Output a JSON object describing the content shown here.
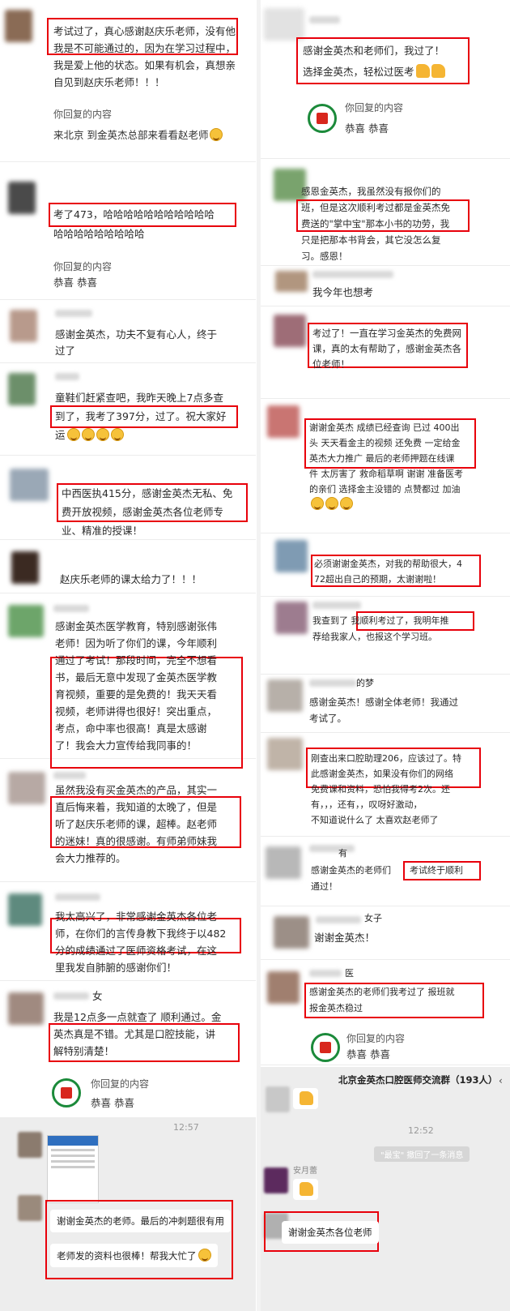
{
  "left_posts": [
    {
      "text": "考试过了，真心感谢赵庆乐老师，没有他我是不可能通过的，因为在学习过程中，我是爱上他的状态。如果有机会，真想亲自见到赵庆乐老师！！！",
      "reply_label": "你回复的内容",
      "reply_body": "来北京 到金英杰总部来看看赵老师"
    },
    {
      "text1": "考了473，哈哈哈哈哈哈哈哈哈哈哈",
      "text2": "哈哈哈哈哈哈哈哈哈",
      "reply_label": "你回复的内容",
      "reply_body": "恭喜 恭喜"
    },
    {
      "text1": "感谢金英杰，功夫不复有心人，终于",
      "text2": "过了"
    },
    {
      "text1": "童鞋们赶紧查吧，我昨天晚上7点多查",
      "text2": "到了，我考了397分，过了。祝大家好",
      "text3": "运"
    },
    {
      "text1": "中西医执415分，感谢金英杰无私、免",
      "text2": "费开放视频，感谢金英杰各位老师专",
      "text3": "业、精准的授课！"
    },
    {
      "text": "赵庆乐老师的课太给力了！！！"
    },
    {
      "lines": [
        "感谢金英杰医学教育，特别感谢张伟",
        "老师！因为听了你们的课，今年顺利",
        "通过了考试！那段时间，完全不想看",
        "书，最后无意中发现了金英杰医学教",
        "育视频，重要的是免费的！我天天看",
        "视频，老师讲得也很好！突出重点，",
        "考点，命中率也很高！真是太感谢",
        "了！我会大力宣传给我同事的！"
      ]
    },
    {
      "lines": [
        "虽然我没有买金英杰的产品，其实一",
        "直后悔来着，我知道的太晚了，但是",
        "听了赵庆乐老师的课，超棒。赵老师",
        "的迷妹！真的很感谢。有师弟师妹我",
        "会大力推荐的。"
      ]
    },
    {
      "lines": [
        "我太高兴了，非常感谢金英杰各位老",
        "师，在你们的言传身教下我终于以482",
        "分的成绩通过了医师资格考试，在这",
        "里我发自肺腑的感谢你们！"
      ]
    },
    {
      "name_char": "女",
      "lines": [
        "我是12点多一点就查了 顺利通过。金",
        "英杰真是不错。尤其是口腔技能，讲",
        "解特别清楚！"
      ],
      "reply_label": "你回复的内容",
      "reply_body": "恭喜 恭喜"
    }
  ],
  "left_chat": {
    "time": "12:57",
    "bubble1": "谢谢金英杰的老师。最后的冲刺题很有用",
    "bubble2": "老师发的资料也很棒！帮我大忙了"
  },
  "right_posts": [
    {
      "text1": "感谢金英杰和老师们，我过了！",
      "text2": "选择金英杰，轻松过医考",
      "reply_label": "你回复的内容",
      "reply_body": "恭喜 恭喜"
    },
    {
      "lines": [
        "感恩金英杰，我虽然没有报你们的",
        "班，但是这次顺利考过都是金英杰免",
        "费送的\"掌中宝\"那本小书的功劳，我",
        "只是把那本书背会，其它没怎么复",
        "习。感恩！"
      ]
    },
    {
      "text": "我今年也想考"
    },
    {
      "lines": [
        "考过了！一直在学习金英杰的免费网",
        "课，真的太有帮助了，感谢金英杰各",
        "位老师！"
      ]
    },
    {
      "lines": [
        "谢谢金英杰 成绩已经查询 已过 400出",
        "头 天天看金主的视频 还免费 一定给金",
        "英杰大力推广 最后的老师押题在线课",
        "件 太厉害了 救命稻草啊 谢谢 准备医考",
        "的亲们 选择金主没错的 点赞都过 加油"
      ]
    },
    {
      "lines": [
        "必须谢谢金英杰，对我的帮助很大，4",
        "72超出自己的预期，太谢谢啦！"
      ]
    },
    {
      "text1": "我查到了 我顺利考过了，我明年推",
      "text2": "荐给我家人，也报这个学习班。"
    },
    {
      "name_tail": "的梦",
      "lines": [
        "感谢金英杰！感谢全体老师！我通过",
        "考试了。"
      ]
    },
    {
      "lines": [
        "刚查出来口腔助理206，应该过了。特",
        "此感谢金英杰，如果没有你们的网络",
        "免费课和资料，恐怕我得考2次。还",
        "有，，，还有，，叹呀好激动，",
        "不知道说什么了 太喜欢赵老师了"
      ]
    },
    {
      "name_tail": "有",
      "text1": "感谢金英杰的老师们",
      "text2": "考试终于顺利",
      "text3": "通过！"
    },
    {
      "name_tail": "女子",
      "text": "谢谢金英杰！"
    },
    {
      "name_tail": "医",
      "text1": "感谢金英杰的老师们我考过了 报班就",
      "text2": "报金英杰稳过",
      "reply_label": "你回复的内容",
      "reply_body": "恭喜 恭喜"
    }
  ],
  "right_chat": {
    "group_title": "北京金英杰口腔医师交流群（193人）",
    "time": "12:52",
    "sys_note": "\"最宝\" 撤回了一条消息",
    "sender": "安月蕾",
    "bubble": "谢谢金英杰各位老师"
  }
}
